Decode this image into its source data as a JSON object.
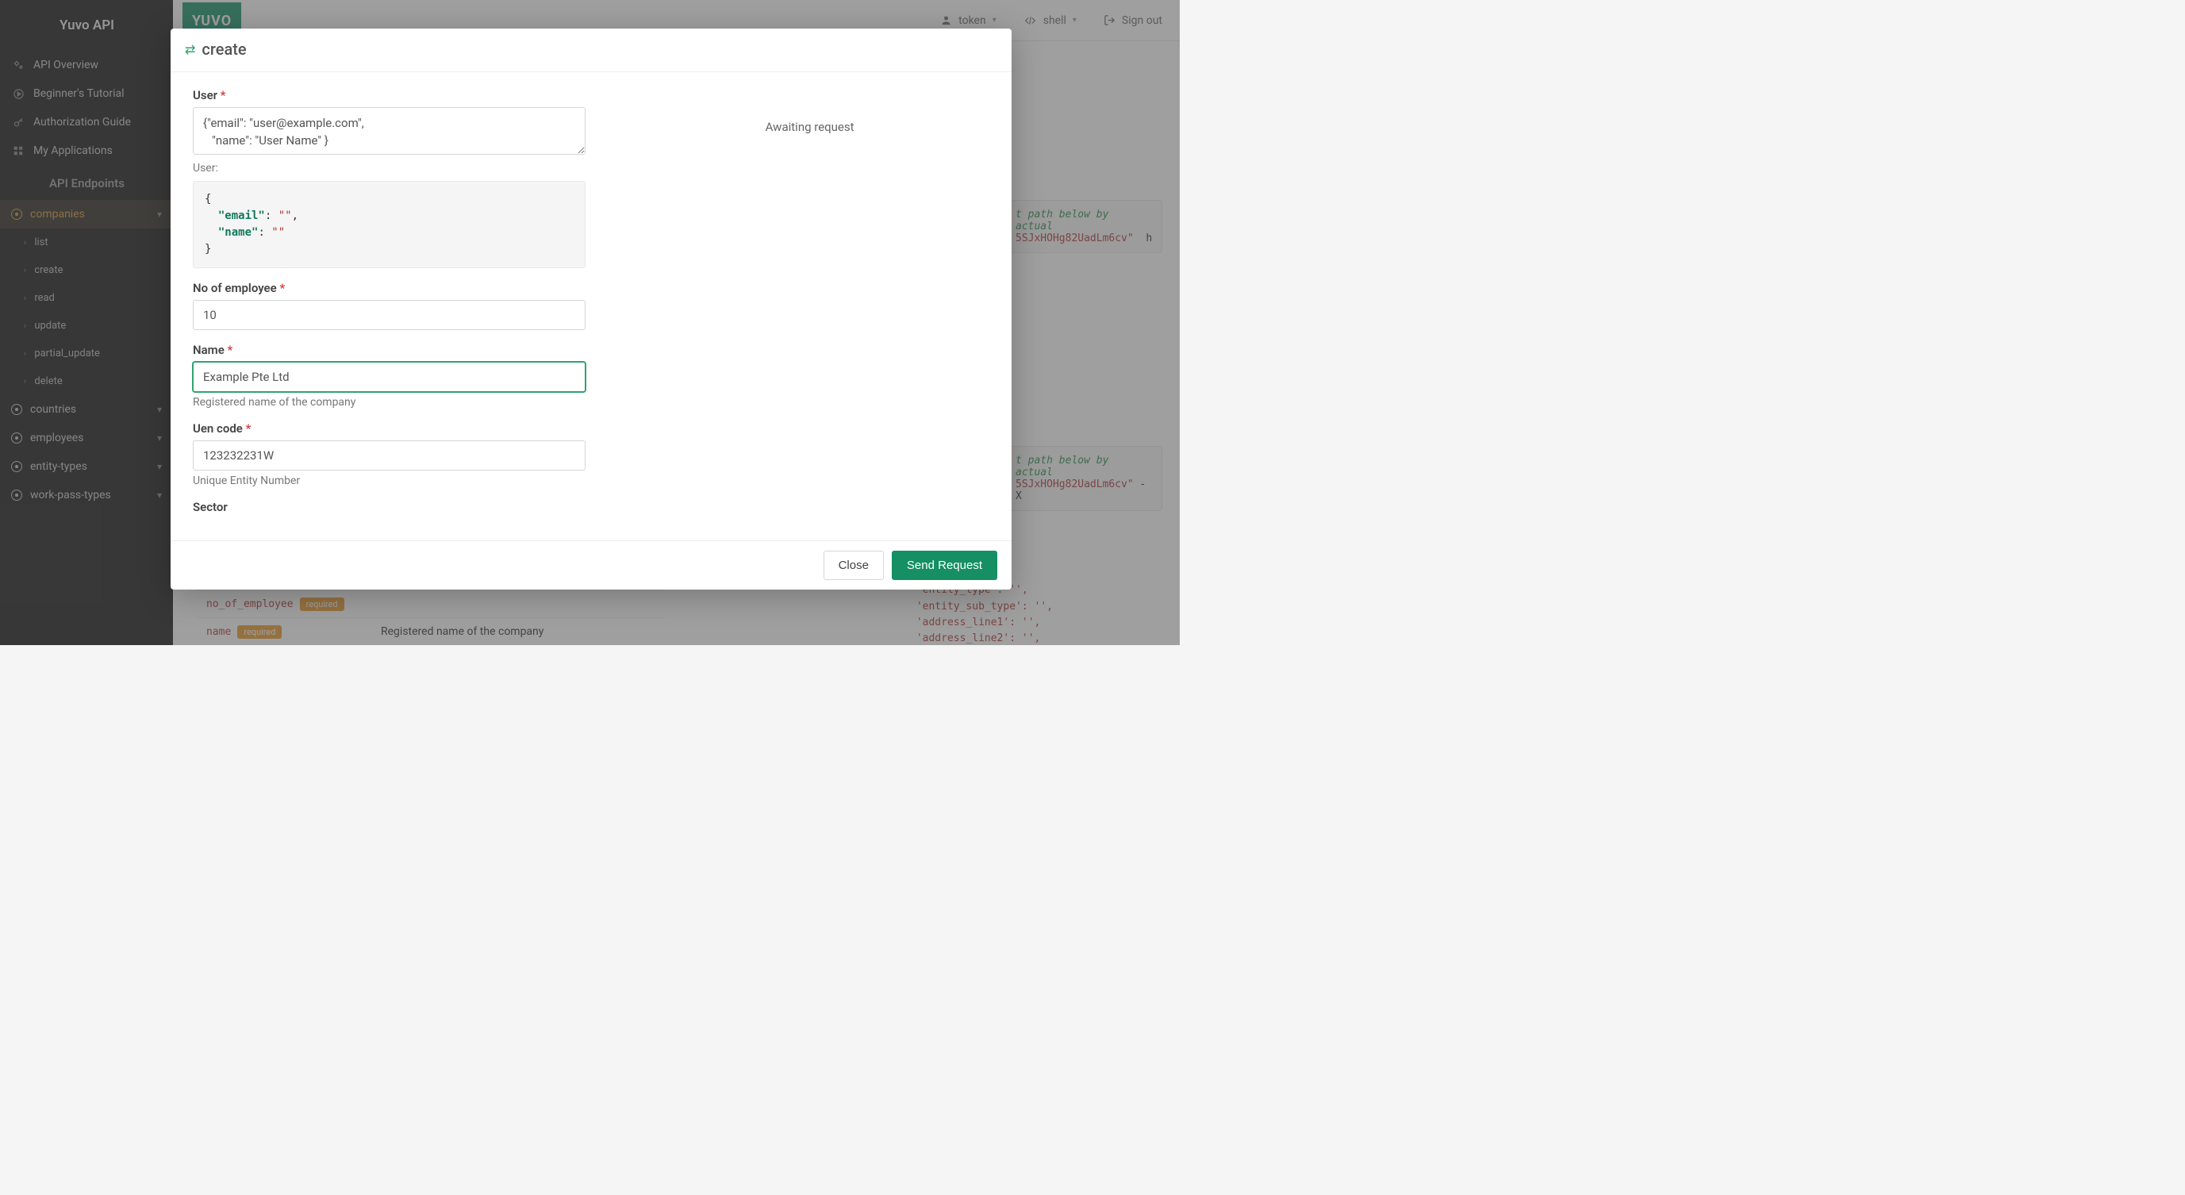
{
  "app": {
    "title": "Yuvo API",
    "logo": "YUVO"
  },
  "sidebar": {
    "nav": [
      {
        "label": "API Overview",
        "icon": "gears"
      },
      {
        "label": "Beginner's Tutorial",
        "icon": "play"
      },
      {
        "label": "Authorization Guide",
        "icon": "key"
      },
      {
        "label": "My Applications",
        "icon": "grid"
      }
    ],
    "section": "API Endpoints",
    "active_endpoint": "companies",
    "active_sub": [
      {
        "label": "list"
      },
      {
        "label": "create"
      },
      {
        "label": "read"
      },
      {
        "label": "update"
      },
      {
        "label": "partial_update"
      },
      {
        "label": "delete"
      }
    ],
    "endpoints": [
      {
        "label": "countries"
      },
      {
        "label": "employees"
      },
      {
        "label": "entity-types"
      },
      {
        "label": "work-pass-types"
      }
    ]
  },
  "topbar": {
    "token_label": "token",
    "shell_label": "shell",
    "signout_label": "Sign out"
  },
  "modal": {
    "title": "create",
    "awaiting": "Awaiting request",
    "fields": {
      "user": {
        "label": "User",
        "value": "{\"email\": \"user@example.com\",\n   \"name\": \"User Name\" }",
        "hint": "User:"
      },
      "user_preview": {
        "email_key": "\"email\"",
        "name_key": "\"name\"",
        "empty": "\"\""
      },
      "no_employee": {
        "label": "No of employee",
        "value": "10"
      },
      "name": {
        "label": "Name",
        "value": "Example Pte Ltd",
        "hint": "Registered name of the company"
      },
      "uen": {
        "label": "Uen code",
        "value": "123232231W",
        "hint": "Unique Entity Number"
      },
      "sector": {
        "label": "Sector"
      }
    },
    "footer": {
      "close": "Close",
      "send": "Send Request"
    }
  },
  "bg": {
    "snippet_comment_1": "t path below by actual",
    "snippet_token_1": "5SJxHOHg82UadLm6cv\"",
    "snippet_suffix_1": "h",
    "snippet_comment_2": "t path below by actual",
    "snippet_token_2": "5SJxHOHg82UadLm6cv\"",
    "snippet_suffix_2": "-X",
    "param_rows": [
      {
        "name": "no_of_employee",
        "badge": "required",
        "desc": ""
      },
      {
        "name": "name",
        "badge": "required",
        "desc": "Registered name of the company"
      }
    ],
    "data_keys": [
      "'entity_type': '',",
      "'entity_sub_type': '',",
      "'address_line1': '',",
      "'address_line2': '',"
    ]
  }
}
